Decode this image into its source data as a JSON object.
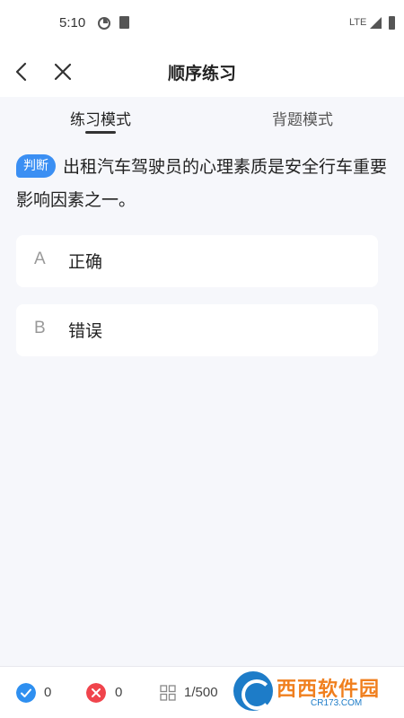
{
  "status_bar": {
    "time": "5:10",
    "network": "LTE"
  },
  "nav": {
    "title": "顺序练习",
    "back_icon": "back-arrow-icon",
    "close_icon": "close-icon"
  },
  "tabs": [
    {
      "label": "练习模式",
      "active": true
    },
    {
      "label": "背题模式",
      "active": false
    }
  ],
  "question": {
    "type_badge": "判断",
    "text": "出租汽车驾驶员的心理素质是安全行车重要影响因素之一。",
    "options": [
      {
        "letter": "A",
        "text": "正确"
      },
      {
        "letter": "B",
        "text": "错误"
      }
    ]
  },
  "bottom_bar": {
    "correct_count": "0",
    "wrong_count": "0",
    "progress": "1/500",
    "correct_color": "#2e8ff0",
    "wrong_color": "#f0444c"
  },
  "colors": {
    "accent": "#3b8ff3",
    "background": "#f6f7fb"
  }
}
